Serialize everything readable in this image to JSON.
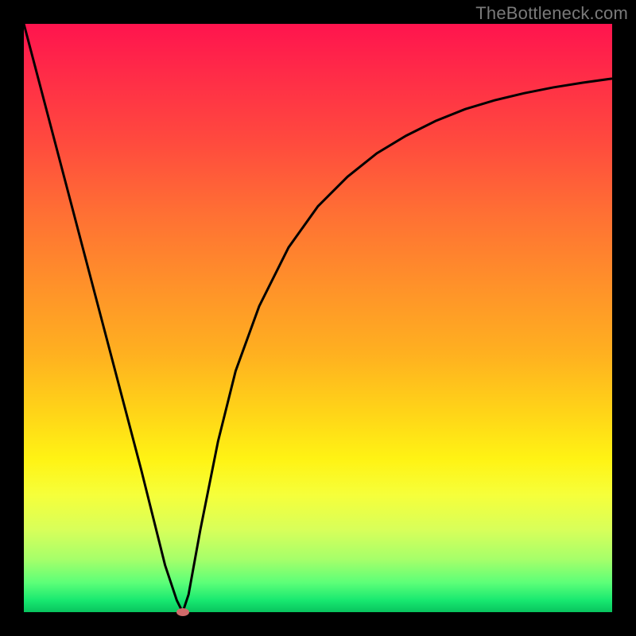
{
  "watermark": "TheBottleneck.com",
  "chart_data": {
    "type": "line",
    "title": "",
    "xlabel": "",
    "ylabel": "",
    "xlim": [
      0,
      100
    ],
    "ylim": [
      0,
      100
    ],
    "grid": false,
    "series": [
      {
        "name": "bottleneck-curve",
        "x": [
          0,
          5,
          10,
          15,
          20,
          24,
          26,
          27,
          28,
          30,
          33,
          36,
          40,
          45,
          50,
          55,
          60,
          65,
          70,
          75,
          80,
          85,
          90,
          95,
          100
        ],
        "y": [
          100,
          81,
          62,
          43,
          24,
          8,
          2,
          0,
          3,
          14,
          29,
          41,
          52,
          62,
          69,
          74,
          78,
          81,
          83.5,
          85.5,
          87,
          88.2,
          89.2,
          90,
          90.7
        ]
      }
    ],
    "annotations": [
      {
        "name": "minimum-marker",
        "x": 27,
        "y": 0,
        "color": "#d06a6a"
      }
    ],
    "colors": {
      "curve": "#000000",
      "background_top": "#ff144e",
      "background_bottom": "#08c45e"
    }
  }
}
